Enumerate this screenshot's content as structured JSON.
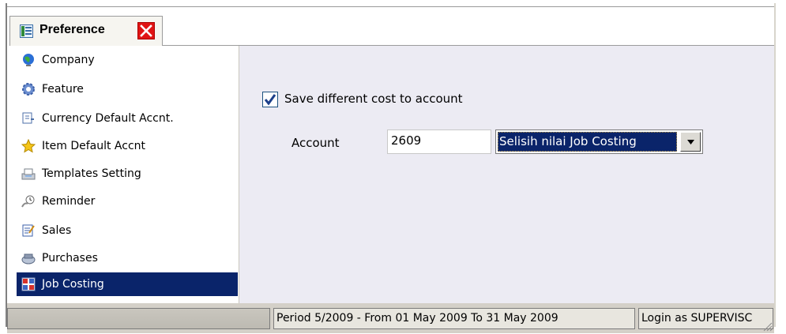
{
  "tab": {
    "title": "Preference",
    "close_icon": "close-icon",
    "icon": "preference-icon"
  },
  "sidebar": {
    "items": [
      {
        "label": "Company",
        "icon": "globe-icon"
      },
      {
        "label": "Feature",
        "icon": "gear-icon"
      },
      {
        "label": "Currency Default Accnt.",
        "icon": "currency-icon"
      },
      {
        "label": "Item Default Accnt",
        "icon": "star-icon"
      },
      {
        "label": "Templates Setting",
        "icon": "templates-icon"
      },
      {
        "label": "Reminder",
        "icon": "reminder-icon"
      },
      {
        "label": "Sales",
        "icon": "sales-icon"
      },
      {
        "label": "Purchases",
        "icon": "purchases-icon"
      },
      {
        "label": "Job Costing",
        "icon": "job-costing-icon",
        "selected": true
      }
    ]
  },
  "main": {
    "save_cost": {
      "label": "Save different cost to account",
      "checked": true
    },
    "account": {
      "label": "Account",
      "code": "2609",
      "selected_name": "Selisih nilai Job Costing"
    }
  },
  "status": {
    "period": "Period 5/2009 - From 01 May 2009 To 31 May 2009",
    "login": "Login as SUPERVISC"
  },
  "colors": {
    "selection": "#0a246a",
    "panel": "#ecebf3",
    "close": "#e01414"
  }
}
